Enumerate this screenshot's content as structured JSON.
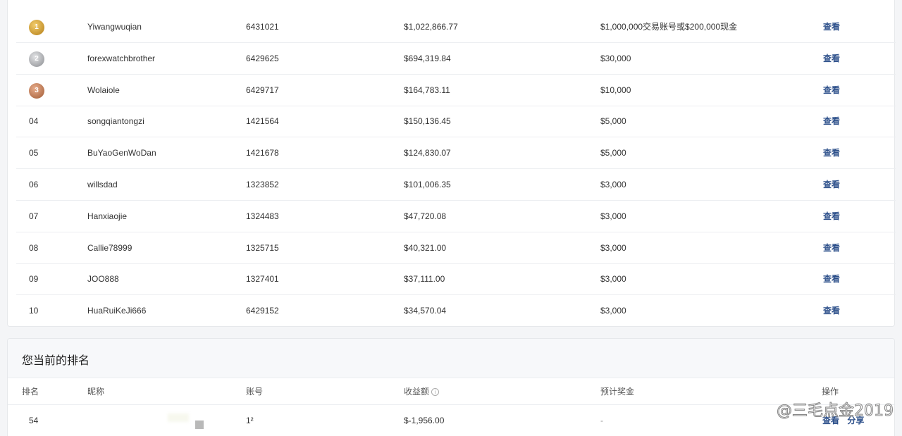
{
  "leaderboard": {
    "rows": [
      {
        "rank": "",
        "medal": "gold",
        "medal_num": "1",
        "nickname": "Yiwangwuqian",
        "account": "6431021",
        "profit": "$1,022,866.77",
        "bonus": "$1,000,000交易账号或$200,000现金",
        "action": "查看"
      },
      {
        "rank": "",
        "medal": "silver",
        "medal_num": "2",
        "nickname": "forexwatchbrother",
        "account": "6429625",
        "profit": "$694,319.84",
        "bonus": "$30,000",
        "action": "查看"
      },
      {
        "rank": "",
        "medal": "bronze",
        "medal_num": "3",
        "nickname": "Wolaiole",
        "account": "6429717",
        "profit": "$164,783.11",
        "bonus": "$10,000",
        "action": "查看"
      },
      {
        "rank": "04",
        "medal": "",
        "medal_num": "",
        "nickname": "songqiantongzi",
        "account": "1421564",
        "profit": "$150,136.45",
        "bonus": "$5,000",
        "action": "查看"
      },
      {
        "rank": "05",
        "medal": "",
        "medal_num": "",
        "nickname": "BuYaoGenWoDan",
        "account": "1421678",
        "profit": "$124,830.07",
        "bonus": "$5,000",
        "action": "查看"
      },
      {
        "rank": "06",
        "medal": "",
        "medal_num": "",
        "nickname": "willsdad",
        "account": "1323852",
        "profit": "$101,006.35",
        "bonus": "$3,000",
        "action": "查看"
      },
      {
        "rank": "07",
        "medal": "",
        "medal_num": "",
        "nickname": "Hanxiaojie",
        "account": "1324483",
        "profit": "$47,720.08",
        "bonus": "$3,000",
        "action": "查看"
      },
      {
        "rank": "08",
        "medal": "",
        "medal_num": "",
        "nickname": "Callie78999",
        "account": "1325715",
        "profit": "$40,321.00",
        "bonus": "$3,000",
        "action": "查看"
      },
      {
        "rank": "09",
        "medal": "",
        "medal_num": "",
        "nickname": "JOO888",
        "account": "1327401",
        "profit": "$37,111.00",
        "bonus": "$3,000",
        "action": "查看"
      },
      {
        "rank": "10",
        "medal": "",
        "medal_num": "",
        "nickname": "HuaRuiKeJi666",
        "account": "6429152",
        "profit": "$34,570.04",
        "bonus": "$3,000",
        "action": "查看"
      }
    ]
  },
  "my_ranking": {
    "title": "您当前的排名",
    "headers": {
      "rank": "排名",
      "nickname": "昵称",
      "account": "账号",
      "profit": "收益额",
      "bonus": "预计奖金",
      "action": "操作"
    },
    "info_icon": "info-icon",
    "row": {
      "rank": "54",
      "nickname": "",
      "account": "1²",
      "profit": "$-1,956.00",
      "bonus": "-",
      "view": "查看",
      "share": "分享"
    }
  },
  "watermark": "@三毛点金2019",
  "colors": {
    "link": "#2c4f8a",
    "card_bg": "#ffffff",
    "page_bg": "#f4f5f7",
    "gold": "#d4a53a",
    "silver": "#a9abae",
    "bronze": "#c27b55"
  }
}
